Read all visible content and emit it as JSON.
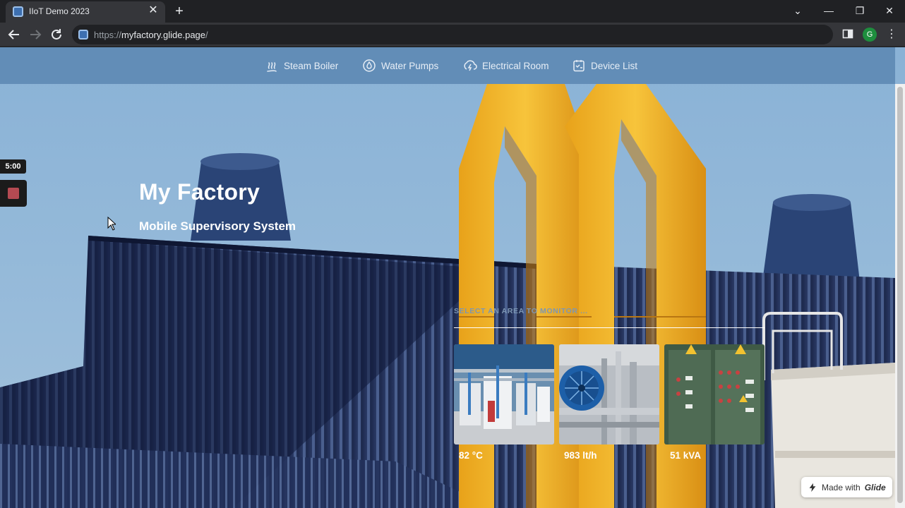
{
  "browser": {
    "tab_title": "IIoT Demo 2023",
    "tab_close": "✕",
    "new_tab": "+",
    "url_scheme": "https://",
    "url_host": "myfactory.glide.page",
    "url_path": "/",
    "profile_initial": "G",
    "window_controls": [
      "⌄",
      "—",
      "❐",
      "✕"
    ]
  },
  "nav": {
    "items": [
      {
        "label": "Steam Boiler",
        "icon": "steam-icon"
      },
      {
        "label": "Water Pumps",
        "icon": "water-drop-icon"
      },
      {
        "label": "Electrical Room",
        "icon": "power-icon"
      },
      {
        "label": "Device List",
        "icon": "checklist-icon"
      }
    ]
  },
  "hero": {
    "title": "My Factory",
    "subtitle": "Mobile Supervisory System"
  },
  "areas": {
    "section_label": "SELECT AN AREA TO MONITOR ...",
    "cards": [
      {
        "value": "82 °C",
        "image": "steam-boiler-room-photo"
      },
      {
        "value": "983 lt/h",
        "image": "water-pump-photo"
      },
      {
        "value": "51 kVA",
        "image": "electrical-panel-photo"
      }
    ]
  },
  "badge": {
    "prefix": "Made with",
    "brand": "Glide"
  },
  "recorder": {
    "timer": "5:00"
  },
  "colors": {
    "nav_bar": "#5c87b3",
    "sky": "#8ab2d6",
    "pipe_yellow": "#f0b21f",
    "building_navy": "#1f2b4f"
  }
}
